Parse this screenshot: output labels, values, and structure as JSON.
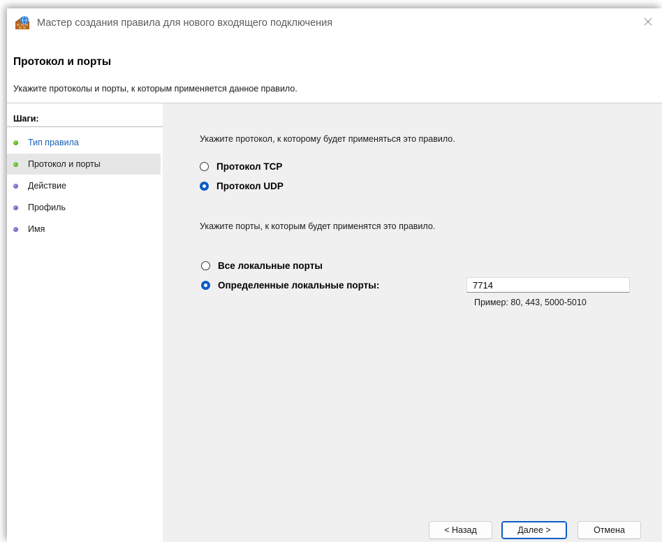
{
  "window": {
    "title": "Мастер создания правила для нового входящего подключения"
  },
  "header": {
    "title": "Протокол и порты",
    "subtitle": "Укажите протоколы и порты, к которым применяется данное правило."
  },
  "steps": {
    "title": "Шаги:",
    "items": [
      {
        "label": "Тип правила",
        "status": "done"
      },
      {
        "label": "Протокол и порты",
        "status": "current"
      },
      {
        "label": "Действие",
        "status": "pending"
      },
      {
        "label": "Профиль",
        "status": "pending"
      },
      {
        "label": "Имя",
        "status": "pending"
      }
    ]
  },
  "protocol": {
    "prompt": "Укажите протокол, к которому будет применяться это правило.",
    "options": [
      {
        "label": "Протокол TCP",
        "checked": false
      },
      {
        "label": "Протокол UDP",
        "checked": true
      }
    ]
  },
  "ports": {
    "prompt": "Укажите порты, к которым будет применятся это правило.",
    "options": [
      {
        "label": "Все локальные порты",
        "checked": false
      },
      {
        "label": "Определенные локальные порты:",
        "checked": true
      }
    ],
    "value": "7714",
    "example": "Пример: 80, 443, 5000-5010"
  },
  "buttons": {
    "back": "< Назад",
    "next": "Далее >",
    "cancel": "Отмена"
  },
  "colors": {
    "accent": "#0c5bc4",
    "link": "#1a5fb4",
    "done_dot": "#3e9a1e",
    "pending_dot": "#4b49b5"
  }
}
